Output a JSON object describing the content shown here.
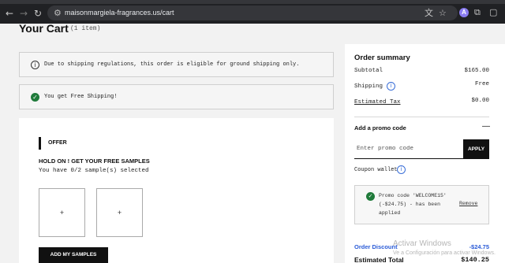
{
  "browser": {
    "url": "maisonmargiela-fragrances.us/cart",
    "profile_initial": "A"
  },
  "cart": {
    "title": "Your Cart",
    "item_count": "(1 item)"
  },
  "notices": {
    "shipping": "Due to shipping regulations, this order is eligible for ground shipping only.",
    "free_shipping": "You get Free Shipping!"
  },
  "offer": {
    "tag": "OFFER",
    "title": "HOLD ON ! GET YOUR FREE SAMPLES",
    "subtitle": "You have 0/2 sample(s) selected",
    "slot_symbol": "+",
    "add_button": "ADD MY SAMPLES"
  },
  "summary": {
    "title": "Order summary",
    "subtotal_label": "Subtotal",
    "subtotal_value": "$165.00",
    "shipping_label": "Shipping",
    "shipping_value": "Free",
    "tax_label": "Estimated Tax",
    "tax_value": "$0.00",
    "promo_heading": "Add a promo code",
    "promo_toggle": "—",
    "promo_placeholder": "Enter promo code",
    "apply_label": "APPLY",
    "wallet_label": "Coupon wallet",
    "applied_message": "Promo code 'WELCOME15' (-$24.75) - has been applied",
    "remove_label": "Remove",
    "discount_label": "Order Discount",
    "discount_value": "-$24.75",
    "total_label": "Estimated Total",
    "total_value": "$140.25"
  },
  "watermark": {
    "line1": "Activar Windows",
    "line2": "Ve a Configuración para activar Windows."
  },
  "colors": {
    "accent_blue": "#2a5bd7",
    "success_green": "#1f7a3a",
    "button_black": "#111111"
  }
}
